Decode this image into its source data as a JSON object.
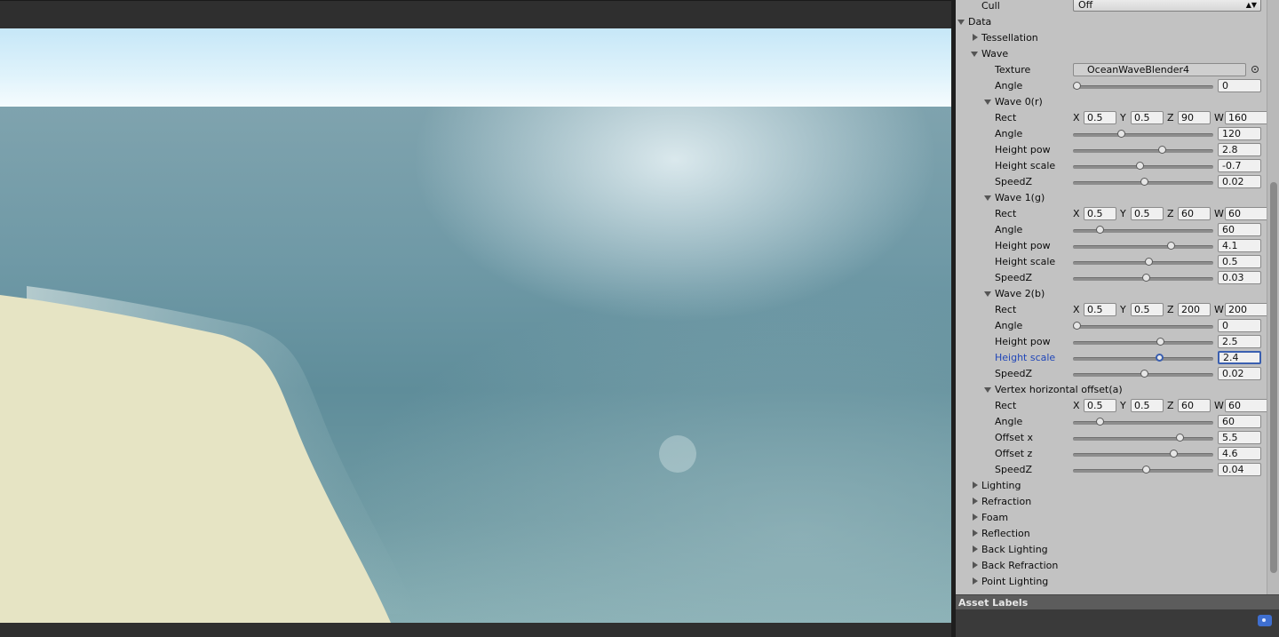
{
  "inspector": {
    "cull": {
      "label": "Cull",
      "value": "Off"
    },
    "data": {
      "label": "Data"
    },
    "tessellation": {
      "label": "Tessellation"
    },
    "wave": {
      "label": "Wave",
      "texture": {
        "label": "Texture",
        "value": "OceanWaveBlender4"
      },
      "angle": {
        "label": "Angle",
        "value": "0",
        "slider": 0.0
      }
    },
    "wave0": {
      "label": "Wave 0(r)",
      "rect": {
        "label": "Rect",
        "x": "0.5",
        "y": "0.5",
        "z": "90",
        "w": "160"
      },
      "angle": {
        "label": "Angle",
        "value": "120",
        "slider": 0.33
      },
      "height_pow": {
        "label": "Height pow",
        "value": "2.8",
        "slider": 0.63
      },
      "height_scale": {
        "label": "Height scale",
        "value": "-0.7",
        "slider": 0.47
      },
      "speedz": {
        "label": "SpeedZ",
        "value": "0.02",
        "slider": 0.5
      }
    },
    "wave1": {
      "label": "Wave 1(g)",
      "rect": {
        "label": "Rect",
        "x": "0.5",
        "y": "0.5",
        "z": "60",
        "w": "60"
      },
      "angle": {
        "label": "Angle",
        "value": "60",
        "slider": 0.17
      },
      "height_pow": {
        "label": "Height pow",
        "value": "4.1",
        "slider": 0.7
      },
      "height_scale": {
        "label": "Height scale",
        "value": "0.5",
        "slider": 0.53
      },
      "speedz": {
        "label": "SpeedZ",
        "value": "0.03",
        "slider": 0.51
      }
    },
    "wave2": {
      "label": "Wave 2(b)",
      "rect": {
        "label": "Rect",
        "x": "0.5",
        "y": "0.5",
        "z": "200",
        "w": "200"
      },
      "angle": {
        "label": "Angle",
        "value": "0",
        "slider": 0.0
      },
      "height_pow": {
        "label": "Height pow",
        "value": "2.5",
        "slider": 0.62
      },
      "height_scale": {
        "label": "Height scale",
        "value": "2.4",
        "slider": 0.61
      },
      "speedz": {
        "label": "SpeedZ",
        "value": "0.02",
        "slider": 0.5
      }
    },
    "vertex": {
      "label": "Vertex horizontal offset(a)",
      "rect": {
        "label": "Rect",
        "x": "0.5",
        "y": "0.5",
        "z": "60",
        "w": "60"
      },
      "angle": {
        "label": "Angle",
        "value": "60",
        "slider": 0.17
      },
      "offset_x": {
        "label": "Offset x",
        "value": "5.5",
        "slider": 0.76
      },
      "offset_z": {
        "label": "Offset z",
        "value": "4.6",
        "slider": 0.72
      },
      "speedz": {
        "label": "SpeedZ",
        "value": "0.04",
        "slider": 0.51
      }
    },
    "sections": {
      "lighting": "Lighting",
      "refraction": "Refraction",
      "foam": "Foam",
      "reflection": "Reflection",
      "back_lighting": "Back Lighting",
      "back_refraction": "Back Refraction",
      "point_lighting": "Point Lighting"
    },
    "axis_letters": {
      "x": "X",
      "y": "Y",
      "z": "Z",
      "w": "W"
    },
    "asset_labels": "Asset Labels"
  },
  "colors": {
    "accent": "#3a5fb0",
    "panel": "#c2c2c2",
    "header": "#5c5c5c"
  }
}
